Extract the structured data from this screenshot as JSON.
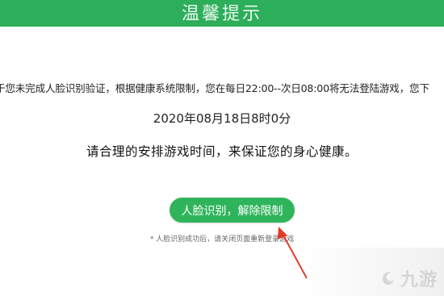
{
  "header": {
    "title": "温馨提示"
  },
  "dialog": {
    "notice": "于您未完成人脸识别验证，根据健康系统限制，您在每日22:00--次日08:00将无法登陆游戏，您下",
    "datetime": "2020年08月18日8时0分",
    "advice": "请合理的安排游戏时间，来保证您的身心健康。",
    "button_label": "人脸识别，解除限制",
    "hint": "* 人脸识别成功后，请关闭页面重新登录游戏"
  },
  "watermark": {
    "text": "九游",
    "icon": "jiuyou-logo-icon"
  },
  "colors": {
    "header": "#2dae5a",
    "button": "#2fb45c",
    "arrow": "#e23c2a"
  }
}
